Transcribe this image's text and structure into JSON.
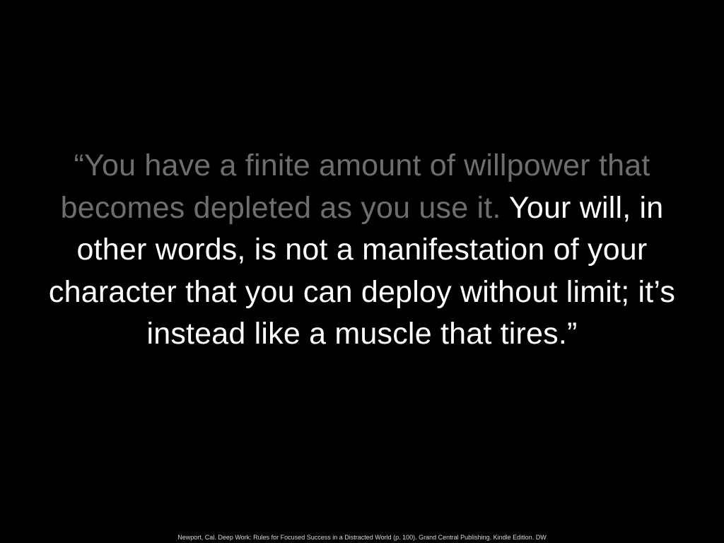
{
  "colors": {
    "background": "#000000",
    "quote_muted": "#6e6e6e",
    "quote_bright": "#ffffff",
    "citation": "#d9d9d9"
  },
  "quote": {
    "muted_text": "“You have a finite amount of willpower that becomes depleted as you use it.",
    "bright_text": "Your will, in other words, is not a manifestation of your character that you can deploy without limit; it’s instead like a muscle that tires.”"
  },
  "citation": "Newport, Cal. Deep Work: Rules for Focused Success in a Distracted World (p. 100). Grand Central Publishing. Kindle Edition. DW"
}
